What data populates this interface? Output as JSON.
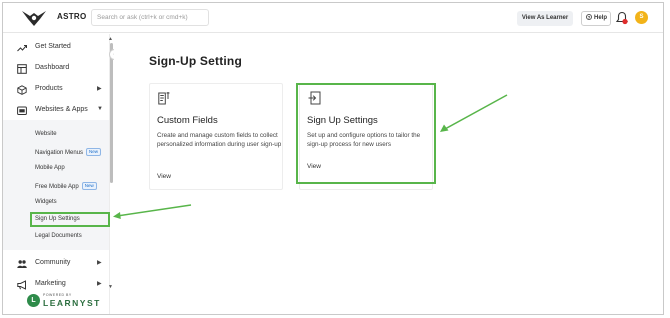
{
  "app": {
    "brand": "ASTRO"
  },
  "header": {
    "search_placeholder": "Search or ask (ctrl+k or cmd+k)",
    "view_as_learner": "View As Learner",
    "help": "Help",
    "avatar_initial": "S"
  },
  "sidebar": {
    "items": [
      {
        "label": "Get Started",
        "icon": "trending-up-icon"
      },
      {
        "label": "Dashboard",
        "icon": "dashboard-icon"
      },
      {
        "label": "Products",
        "icon": "cube-icon"
      },
      {
        "label": "Websites & Apps",
        "icon": "websites-icon"
      },
      {
        "label": "Community",
        "icon": "people-icon"
      },
      {
        "label": "Marketing",
        "icon": "megaphone-icon"
      }
    ],
    "sub_items": [
      {
        "label": "Website"
      },
      {
        "label": "Navigation Menus",
        "badge": "New"
      },
      {
        "label": "Mobile App"
      },
      {
        "label": "Free Mobile App",
        "badge": "New"
      },
      {
        "label": "Widgets"
      },
      {
        "label": "Sign Up Settings"
      },
      {
        "label": "Legal Documents"
      }
    ],
    "footer": {
      "powered_by": "POWERED BY",
      "brand": "LEARNYST"
    }
  },
  "main": {
    "title": "Sign-Up Setting",
    "cards": [
      {
        "title": "Custom Fields",
        "description": "Create and manage custom fields to collect personalized information during user sign-up",
        "link": "View",
        "icon": "custom-fields-icon"
      },
      {
        "title": "Sign Up Settings",
        "description": "Set up and configure options to tailor the sign-up process for new users",
        "link": "View",
        "icon": "sign-in-icon"
      }
    ]
  },
  "colors": {
    "highlight": "#58b54a",
    "avatar": "#f2b319",
    "badge": "#1d6ec9",
    "brand_green": "#2e8b4a"
  }
}
